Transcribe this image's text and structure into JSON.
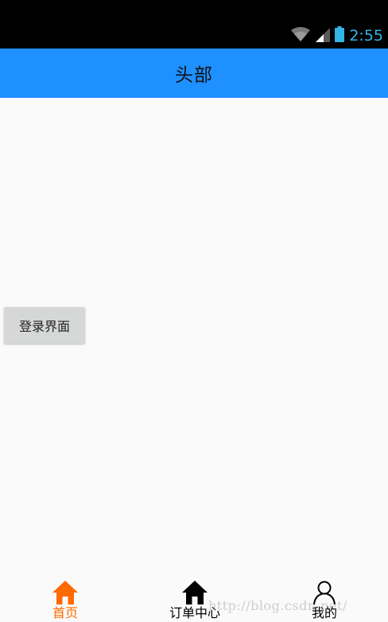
{
  "status_bar": {
    "time": "2:55",
    "icons": [
      "wifi-icon",
      "cell-signal-icon",
      "battery-icon"
    ],
    "time_color": "#33b5e5"
  },
  "header": {
    "title": "头部",
    "background": "#1e90ff"
  },
  "main": {
    "login_button_label": "登录界面"
  },
  "tab_bar": {
    "tabs": [
      {
        "label": "首页",
        "icon": "home-icon",
        "active": true,
        "color": "#ff6a00"
      },
      {
        "label": "订单中心",
        "icon": "home-icon",
        "active": false,
        "color": "#000000"
      },
      {
        "label": "我的",
        "icon": "person-icon",
        "active": false,
        "color": "#000000"
      }
    ]
  },
  "watermark": "http://blog.csdn.net/"
}
